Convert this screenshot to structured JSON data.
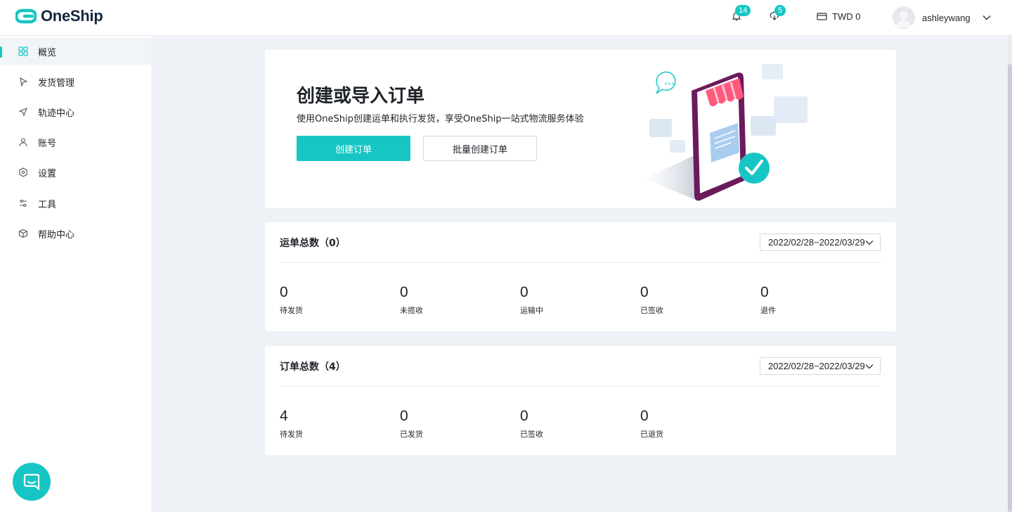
{
  "brand": {
    "name": "OneShip",
    "accent": "#17c6c4",
    "text_color": "#14253f"
  },
  "header": {
    "notifications": {
      "icon": "bell-icon",
      "count": "14"
    },
    "downloads": {
      "icon": "download-icon",
      "count": "5"
    },
    "wallet": {
      "icon": "wallet-icon",
      "label": "TWD 0"
    },
    "user": {
      "name": "ashleywang",
      "icon": "chevron-down-icon"
    }
  },
  "sidebar": {
    "items": [
      {
        "label": "概览",
        "icon": "overview-grid-icon",
        "active": true
      },
      {
        "label": "发货管理",
        "icon": "shipping-icon"
      },
      {
        "label": "轨迹中心",
        "icon": "navigation-arrow-icon"
      },
      {
        "label": "账号",
        "icon": "user-icon"
      },
      {
        "label": "设置",
        "icon": "settings-icon"
      },
      {
        "label": "工具",
        "icon": "tools-icon"
      },
      {
        "label": "帮助中心",
        "icon": "box-icon"
      }
    ]
  },
  "hero": {
    "title": "创建或导入订单",
    "subtitle": "使用OneShip创建运单和执行发货，享受OneShip一站式物流服务体验",
    "primary_button": "创建订单",
    "secondary_button": "批量创建订单"
  },
  "shipments": {
    "title": "运单总数（0）",
    "date_range": "2022/02/28~2022/03/29",
    "stats": [
      {
        "value": "0",
        "label": "待发货"
      },
      {
        "value": "0",
        "label": "未揽收"
      },
      {
        "value": "0",
        "label": "运输中"
      },
      {
        "value": "0",
        "label": "已签收"
      },
      {
        "value": "0",
        "label": "退件"
      }
    ]
  },
  "orders": {
    "title": "订单总数（4）",
    "date_range": "2022/02/28~2022/03/29",
    "stats": [
      {
        "value": "4",
        "label": "待发货"
      },
      {
        "value": "0",
        "label": "已发货"
      },
      {
        "value": "0",
        "label": "已签收"
      },
      {
        "value": "0",
        "label": "已退货"
      }
    ]
  },
  "chat": {
    "icon": "chat-icon"
  }
}
